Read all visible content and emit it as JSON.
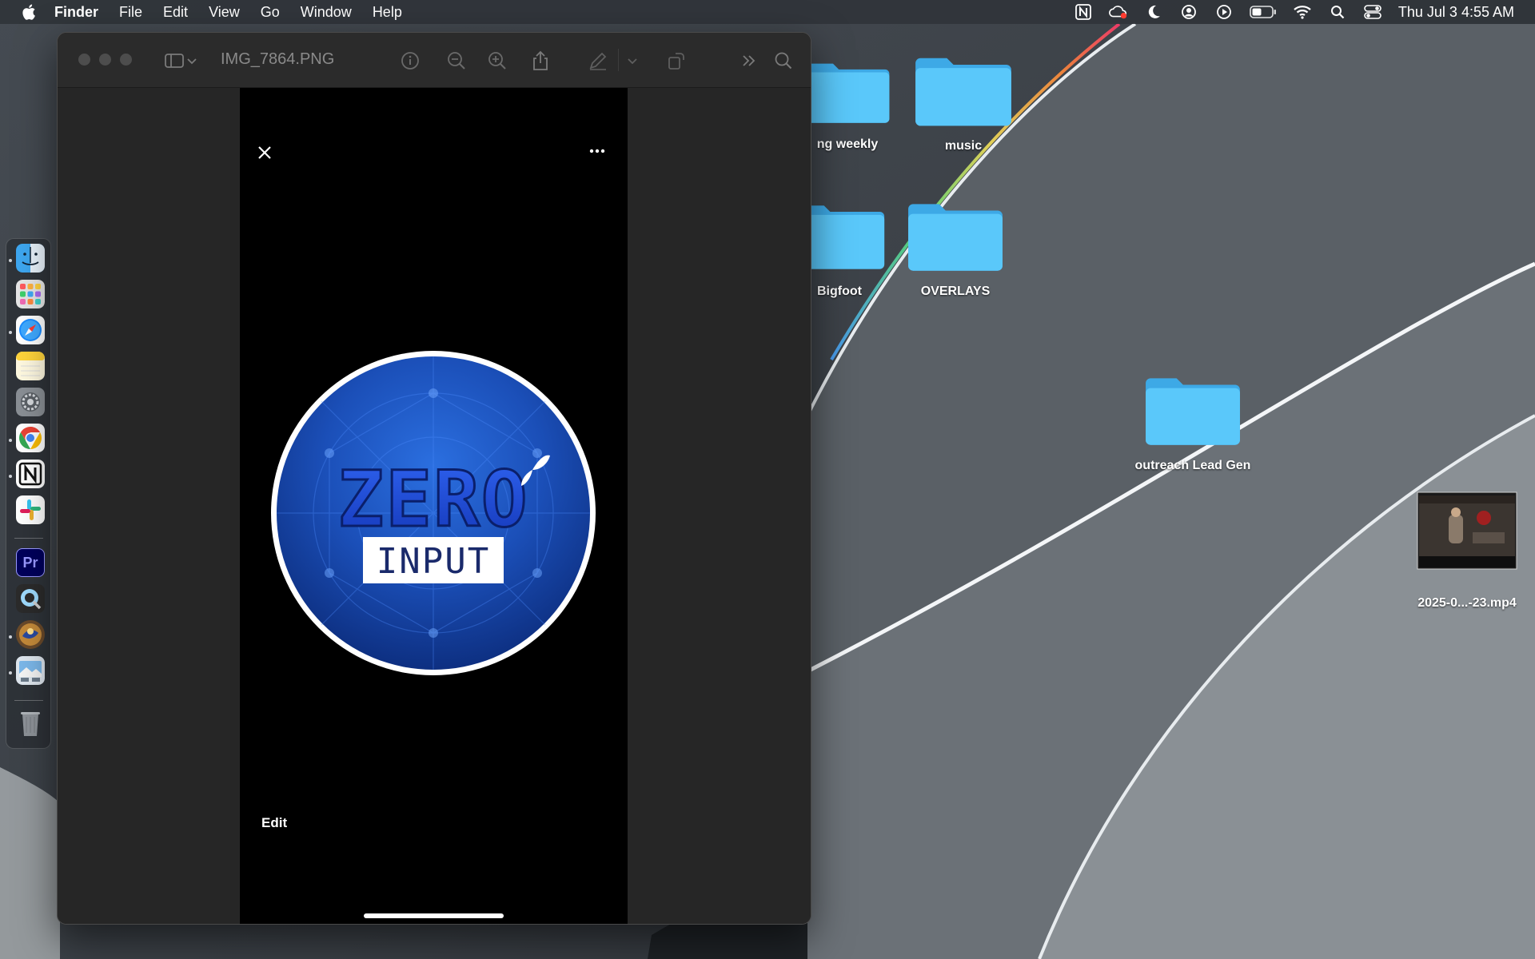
{
  "menubar": {
    "app_name": "Finder",
    "items": [
      "File",
      "Edit",
      "View",
      "Go",
      "Window",
      "Help"
    ],
    "clock": "Thu Jul 3  4:55 AM",
    "status_icons": [
      "notion-icon",
      "creative-cloud-icon",
      "moon-icon",
      "user-circle-icon",
      "play-circle-icon",
      "battery-icon",
      "wifi-icon",
      "search-icon",
      "control-center-icon"
    ]
  },
  "desktop": {
    "items": [
      {
        "label": "ng weekly",
        "kind": "folder"
      },
      {
        "label": "music",
        "kind": "folder"
      },
      {
        "label": "Bigfoot",
        "kind": "folder"
      },
      {
        "label": "OVERLAYS",
        "kind": "folder"
      },
      {
        "label": "outreach Lead Gen",
        "kind": "folder"
      },
      {
        "label": "2025-0...-23.mp4",
        "kind": "video"
      }
    ]
  },
  "dock": {
    "apps": [
      "finder-icon",
      "launchpad-icon",
      "safari-icon",
      "notes-icon",
      "system-settings-icon",
      "chrome-icon",
      "notion-icon",
      "slack-icon",
      "premiere-pro-icon",
      "quicktime-icon",
      "app-icon",
      "preview-icon",
      "trash-icon"
    ],
    "premiere_label": "Pr"
  },
  "window": {
    "title": "IMG_7864.PNG",
    "toolbar": [
      "sidebar-icon",
      "chevron-down-icon",
      "info-icon",
      "zoom-out-icon",
      "zoom-in-icon",
      "share-icon",
      "markup-icon",
      "chevron-down-icon",
      "rotate-icon",
      "more-chevrons-icon",
      "search-icon"
    ]
  },
  "image": {
    "logo_top": "ZERO",
    "logo_bottom": "INPUT",
    "edit_label": "Edit"
  },
  "colors": {
    "folder": "#5ac8fa",
    "logo_blue": "#1e56d6",
    "window_bg": "#262626"
  }
}
